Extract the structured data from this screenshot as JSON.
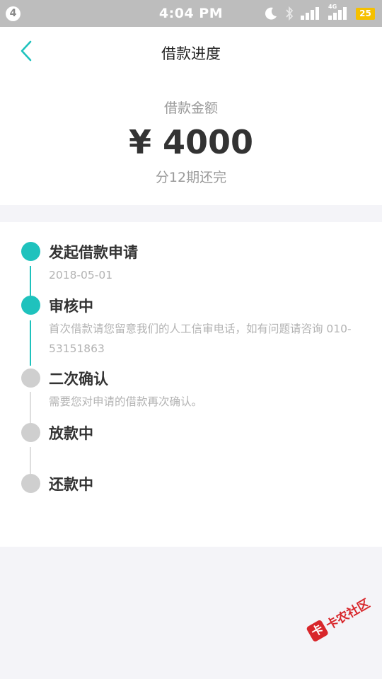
{
  "status_bar": {
    "notification_count": "4",
    "time": "4:04 PM",
    "network_label": "4G",
    "battery": "25",
    "icons": [
      "moon-icon",
      "bluetooth-icon",
      "signal-icon",
      "signal-4g-icon",
      "battery-icon"
    ]
  },
  "header": {
    "title": "借款进度",
    "back_icon": "chevron-left-icon"
  },
  "loan": {
    "amount_label": "借款金额",
    "amount": "¥ 4000",
    "installments": "分12期还完"
  },
  "steps": [
    {
      "title": "发起借款申请",
      "detail": "2018-05-01",
      "status": "done"
    },
    {
      "title": "审核中",
      "detail": "首次借款请您留意我们的人工信审电话，如有问题请咨询 010-53151863",
      "status": "done"
    },
    {
      "title": "二次确认",
      "detail": "需要您对申请的借款再次确认。",
      "status": "pending"
    },
    {
      "title": "放款中",
      "detail": "",
      "status": "pending"
    },
    {
      "title": "还款中",
      "detail": "",
      "status": "pending"
    }
  ],
  "colors": {
    "accent": "#1fc2bd",
    "pending": "#cfcfcf",
    "status_bar": "#bdbdbd",
    "watermark": "#d8262b"
  },
  "watermark": {
    "badge": "卡",
    "text": "卡农社区"
  }
}
